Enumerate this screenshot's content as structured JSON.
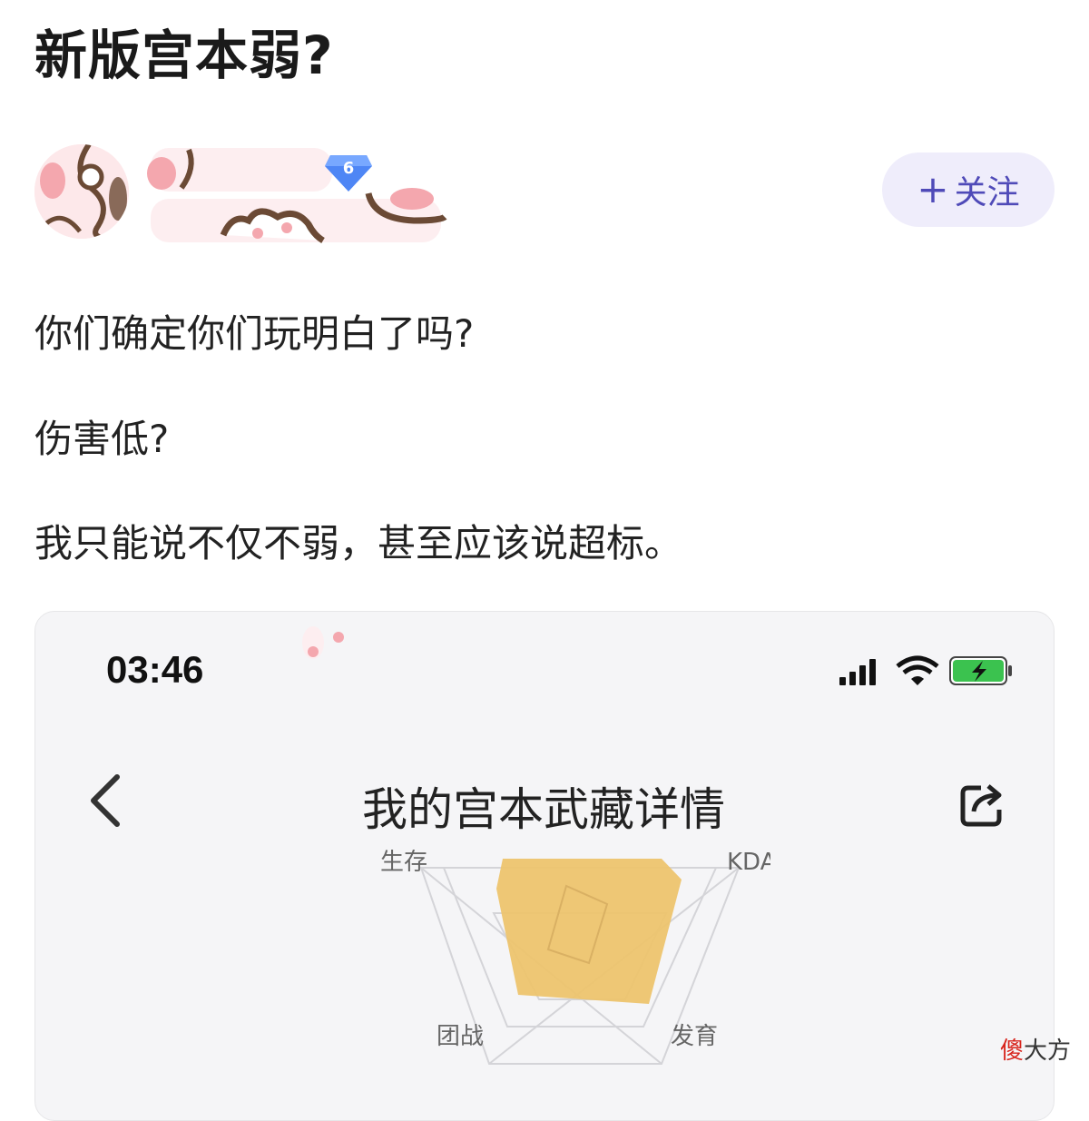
{
  "post": {
    "title": "新版宫本弱?"
  },
  "author": {
    "level": "6",
    "follow_label": "关注",
    "follow_plus": "+"
  },
  "content": {
    "paragraphs": [
      "你们确定你们玩明白了吗?",
      "伤害低?",
      "我只能说不仅不弱，甚至应该说超标。"
    ]
  },
  "embedded_screenshot": {
    "time": "03:46",
    "page_title": "我的宫本武藏详情",
    "icons": [
      "back-chevron-icon",
      "share-icon",
      "signal-icon",
      "wifi-icon",
      "battery-charging-icon"
    ],
    "radar": {
      "axes": [
        "生存",
        "KDA",
        "团战",
        "发育"
      ],
      "fill_color": "#edc46e"
    }
  },
  "watermark": {
    "red_char": "傻",
    "rest": "大方"
  }
}
